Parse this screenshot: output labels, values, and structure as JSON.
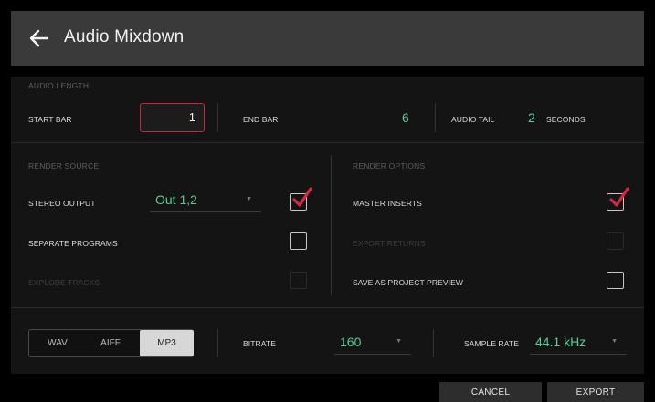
{
  "header": {
    "title": "Audio Mixdown",
    "back_icon": "back-arrow-icon"
  },
  "audio_length": {
    "section_label": "AUDIO LENGTH",
    "start_bar_label": "START BAR",
    "start_bar_value": "1",
    "end_bar_label": "END BAR",
    "end_bar_value": "6",
    "audio_tail_label": "AUDIO TAIL",
    "audio_tail_value": "2",
    "audio_tail_unit": "SECONDS"
  },
  "render_source": {
    "section_label": "RENDER SOURCE",
    "stereo_output_label": "STEREO OUTPUT",
    "stereo_output_value": "Out 1,2",
    "stereo_output_checked": true,
    "separate_programs_label": "SEPARATE PROGRAMS",
    "separate_programs_checked": false,
    "explode_tracks_label": "EXPLODE TRACKS",
    "explode_tracks_enabled": false
  },
  "render_options": {
    "section_label": "RENDER OPTIONS",
    "master_inserts_label": "MASTER INSERTS",
    "master_inserts_checked": true,
    "export_returns_label": "EXPORT RETURNS",
    "export_returns_enabled": false,
    "save_preview_label": "SAVE AS PROJECT PREVIEW",
    "save_preview_checked": false
  },
  "format": {
    "options": [
      "WAV",
      "AIFF",
      "MP3"
    ],
    "selected": "MP3",
    "bitrate_label": "BITRATE",
    "bitrate_value": "160",
    "sample_rate_label": "SAMPLE RATE",
    "sample_rate_value": "44.1 kHz"
  },
  "footer": {
    "cancel_label": "CANCEL",
    "export_label": "EXPORT"
  },
  "colors": {
    "accent_green": "#4fcf94",
    "check_red": "#d6283c",
    "header_bg": "#3a3a3a",
    "panel_bg": "#141414"
  }
}
